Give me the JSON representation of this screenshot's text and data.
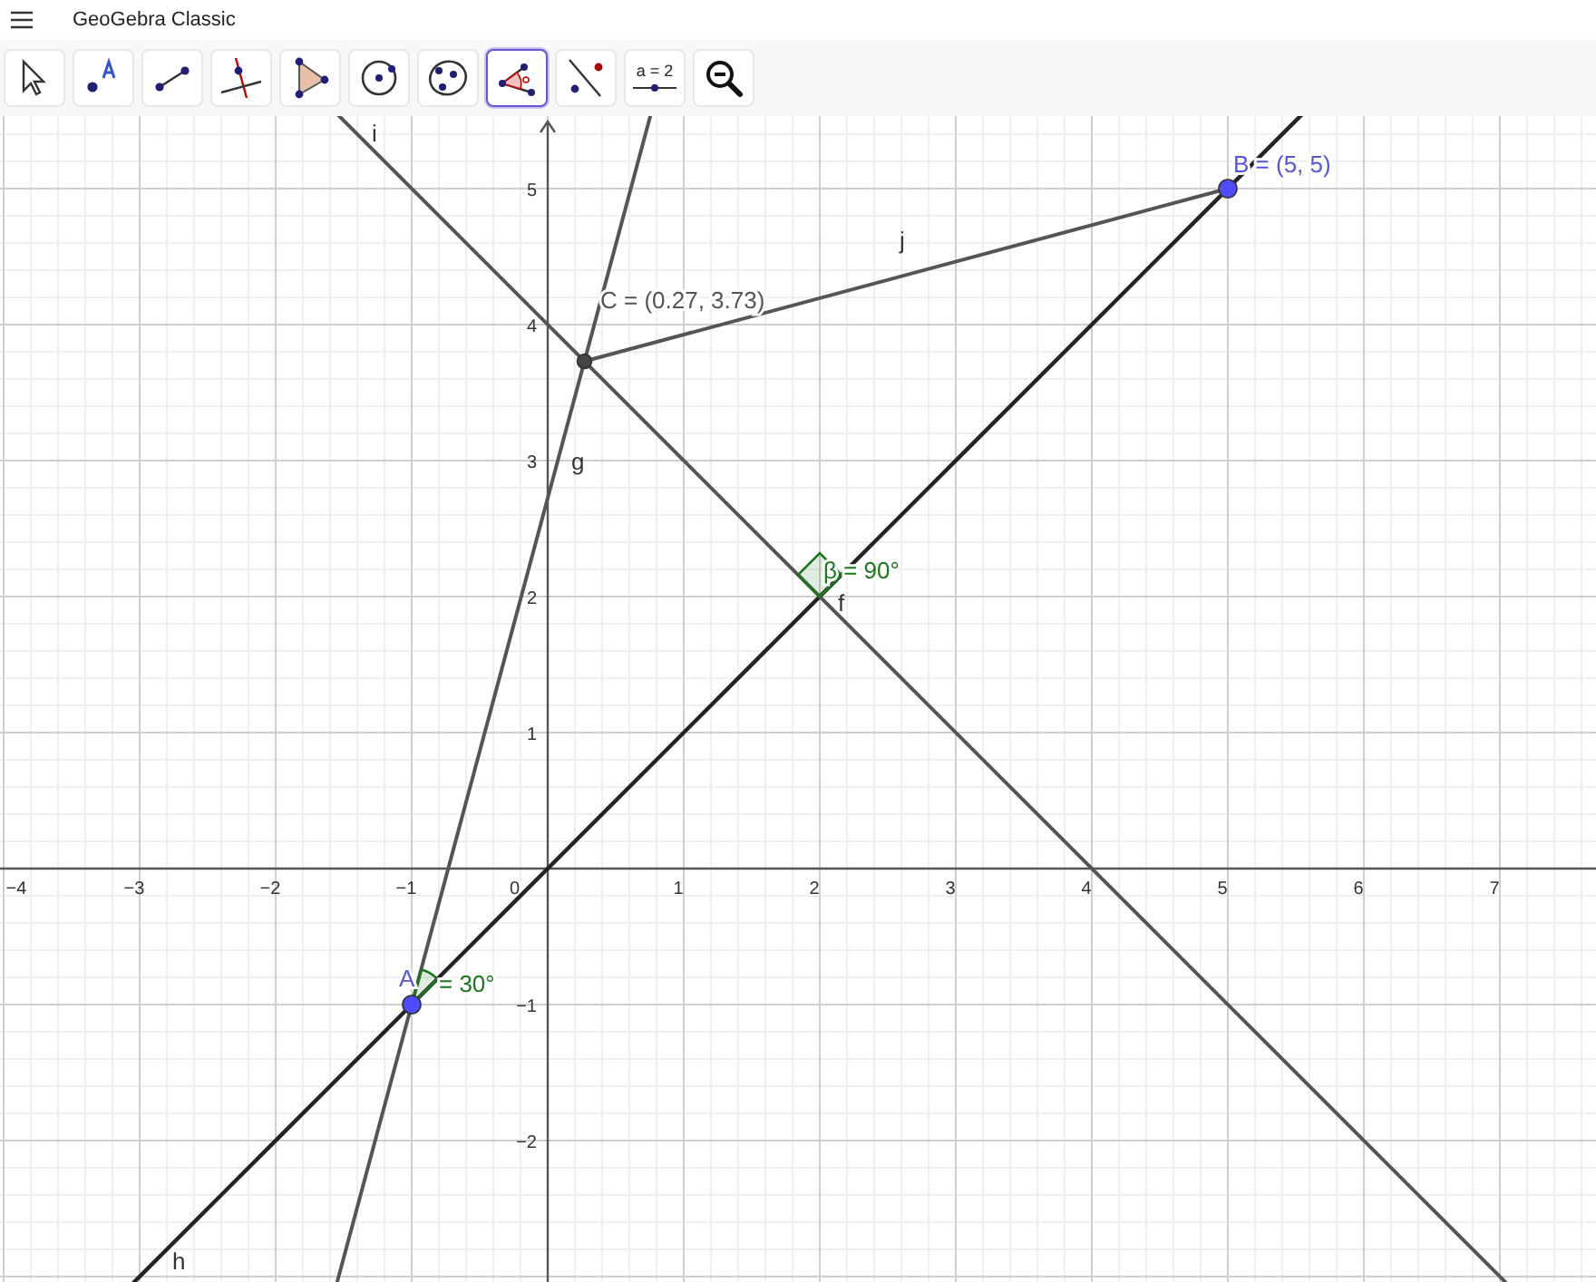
{
  "header": {
    "title": "GeoGebra Classic"
  },
  "toolbar": [
    {
      "kind": "move",
      "selected": false
    },
    {
      "kind": "point",
      "selected": false
    },
    {
      "kind": "segment",
      "selected": false
    },
    {
      "kind": "perpendicular",
      "selected": false
    },
    {
      "kind": "polygon",
      "selected": false
    },
    {
      "kind": "circle",
      "selected": false
    },
    {
      "kind": "conic",
      "selected": false
    },
    {
      "kind": "angle",
      "selected": true
    },
    {
      "kind": "reflect",
      "selected": false
    },
    {
      "kind": "slider",
      "label": "a = 2",
      "selected": false
    },
    {
      "kind": "zoom",
      "selected": false
    }
  ],
  "graphics": {
    "x_ticks": [
      "−4",
      "−3",
      "−2",
      "−1",
      "1",
      "2",
      "3",
      "4",
      "5",
      "6",
      "7"
    ],
    "y_ticks": [
      "5",
      "4",
      "3",
      "2",
      "1",
      "−1",
      "−2"
    ],
    "origin": "0",
    "lines": [
      {
        "label": "h"
      },
      {
        "label": "i"
      },
      {
        "label": "g"
      },
      {
        "label": "j"
      },
      {
        "label": "f"
      }
    ],
    "points": [
      {
        "label": "A",
        "color": "#4d4dff"
      },
      {
        "label": "B = (5, 5)",
        "color": "#4d4dff"
      },
      {
        "label": "C = (0.27, 3.73)",
        "color": "#444444"
      }
    ],
    "angles": [
      {
        "label": "β = 90°"
      },
      {
        "label": "= 30°"
      }
    ]
  }
}
